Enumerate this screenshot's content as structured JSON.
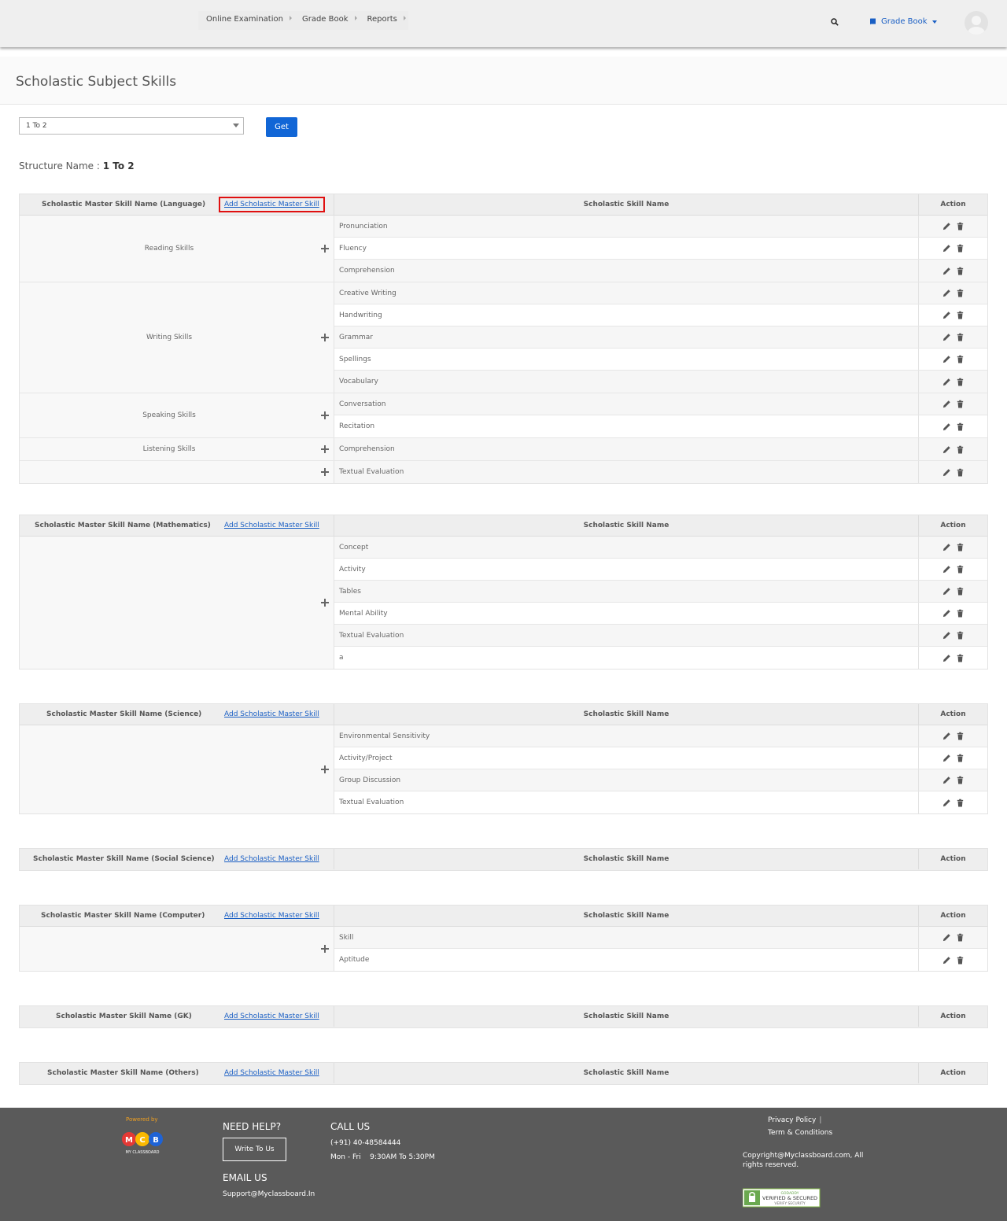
{
  "nav": {
    "menu": [
      "Online Examination",
      "Grade Book",
      "Reports"
    ],
    "dropdown_label": "Grade Book",
    "accent": "#1a5fc4"
  },
  "page": {
    "title": "Scholastic Subject Skills",
    "select_value": "1 To 2",
    "get_label": "Get",
    "structure_label": "Structure Name :",
    "structure_value": "1 To 2"
  },
  "table_headers": {
    "skill_col": "Scholastic Skill Name",
    "action_col": "Action",
    "add_link": "Add Scholastic Master Skill"
  },
  "tables": [
    {
      "master_label": "Scholastic Master Skill Name (Language)",
      "groups": [
        {
          "name": "Reading Skills",
          "skills": [
            "Pronunciation",
            "Fluency",
            "Comprehension"
          ]
        },
        {
          "name": "Writing Skills",
          "skills": [
            "Creative Writing",
            "Handwriting",
            "Grammar",
            "Spellings",
            "Vocabulary"
          ]
        },
        {
          "name": "Speaking Skills",
          "skills": [
            "Conversation",
            "Recitation"
          ]
        },
        {
          "name": "Listening Skills",
          "skills": [
            "Comprehension"
          ]
        },
        {
          "name": "",
          "skills": [
            "Textual Evaluation"
          ]
        }
      ]
    },
    {
      "master_label": "Scholastic Master Skill Name (Mathematics)",
      "groups": [
        {
          "name": "",
          "skills": [
            "Concept",
            "Activity",
            "Tables",
            "Mental Ability",
            "Textual Evaluation",
            "a"
          ]
        }
      ]
    },
    {
      "master_label": "Scholastic Master Skill Name (Science)",
      "groups": [
        {
          "name": "",
          "skills": [
            "Environmental Sensitivity",
            "Activity/Project",
            "Group Discussion",
            "Textual Evaluation"
          ]
        }
      ]
    },
    {
      "master_label": "Scholastic Master Skill Name (Social Science)",
      "groups": []
    },
    {
      "master_label": "Scholastic Master Skill Name (Computer)",
      "groups": [
        {
          "name": "",
          "skills": [
            "Skill",
            "Aptitude"
          ]
        }
      ]
    },
    {
      "master_label": "Scholastic Master Skill Name (GK)",
      "groups": []
    },
    {
      "master_label": "Scholastic Master Skill Name (Others)",
      "groups": []
    }
  ],
  "footer": {
    "powered_by": "Powered by",
    "logo_letters": [
      "M",
      "C",
      "B"
    ],
    "logo_caption": "MY CLASSBOARD",
    "need_help": "NEED HELP?",
    "write_to_us": "Write To Us",
    "email_title": "EMAIL US",
    "email": "Support@Myclassboard.In",
    "call_title": "CALL US",
    "phone": "(+91) 40-48584444",
    "hours": "Mon - Fri    9:30AM To 5:30PM",
    "privacy": "Privacy Policy",
    "privacy_sep": "|",
    "terms": "Term & Conditions",
    "copyright": "Copyright@Myclassboard.com, All rights reserved.",
    "badge_top": "GODADDY",
    "badge_main": "VERIFIED & SECURED",
    "badge_sub": "VERIFY SECURITY"
  }
}
